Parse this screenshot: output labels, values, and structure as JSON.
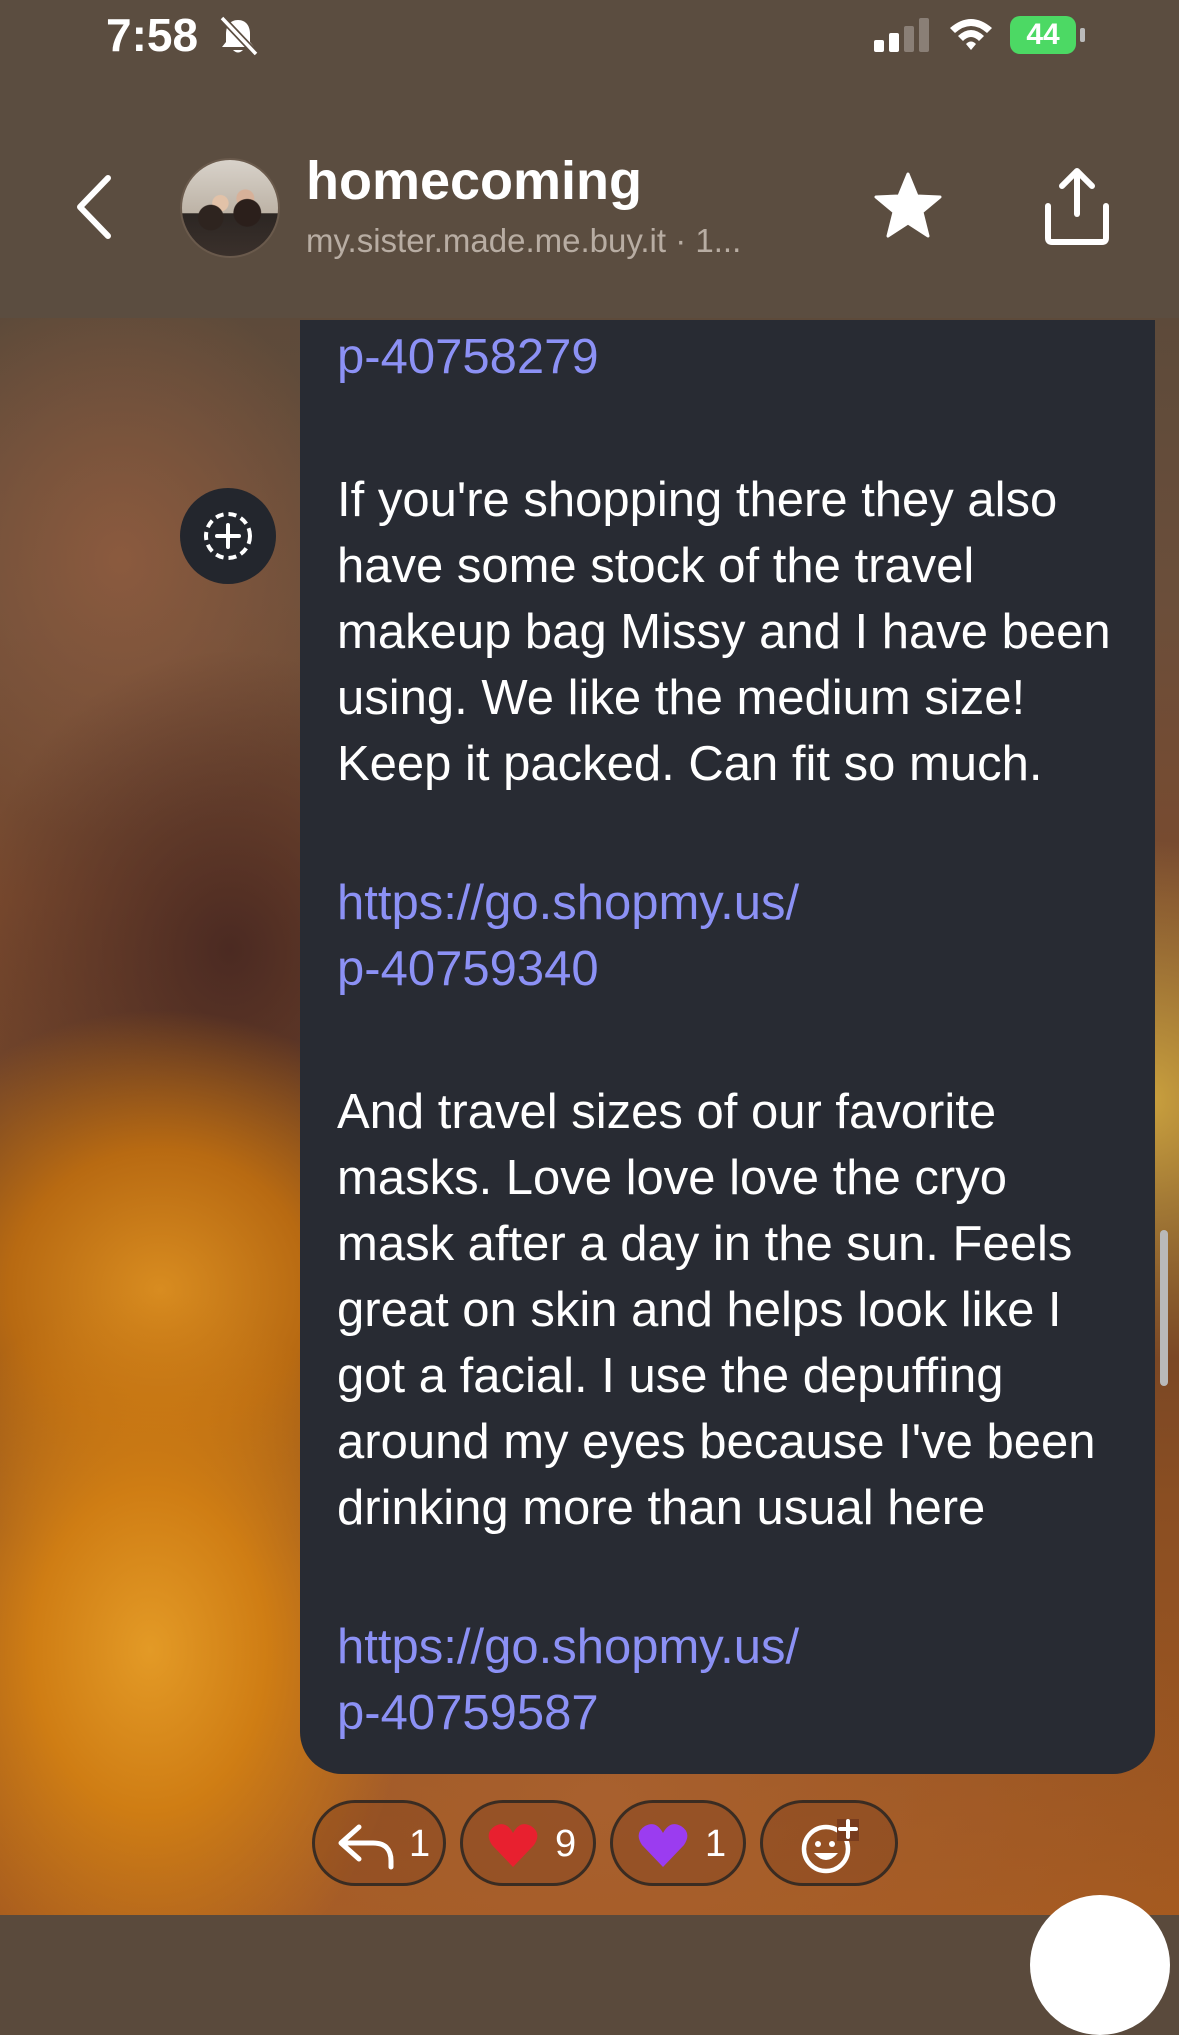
{
  "status_bar": {
    "time": "7:58",
    "battery": "44",
    "icons": [
      "bell-slash-icon",
      "cellular-signal-icon",
      "wifi-icon",
      "battery-charging-icon"
    ]
  },
  "header": {
    "title": "homecoming",
    "subtitle": "my.sister.made.me.buy.it  · 1...",
    "icons": [
      "back-chevron-icon",
      "star-icon",
      "share-icon"
    ]
  },
  "message": {
    "link_top": "p-40758279",
    "paragraph_1": "If you're shopping there they also have some stock of the travel makeup bag Missy and I have been using. We like the medium size! Keep it packed. Can fit so much.",
    "link_1_line1": "https://go.shopmy.us/",
    "link_1_line2": "p-40759340",
    "paragraph_2": "And travel sizes of our favorite masks. Love love love the cryo mask after a day in the sun. Feels great on skin and helps look like I got a facial. I use the depuffing around my eyes because I've been drinking more than usual here",
    "link_2_line1": "https://go.shopmy.us/",
    "link_2_line2": "p-40759587"
  },
  "reactions": {
    "reply_count": "1",
    "heart_count": "9",
    "purple_heart_count": "1",
    "add_reaction_icon": "add-emoji-icon"
  },
  "colors": {
    "bubble": "#282b33",
    "link": "#8c91f5",
    "header_bg": "#5b4d40"
  }
}
